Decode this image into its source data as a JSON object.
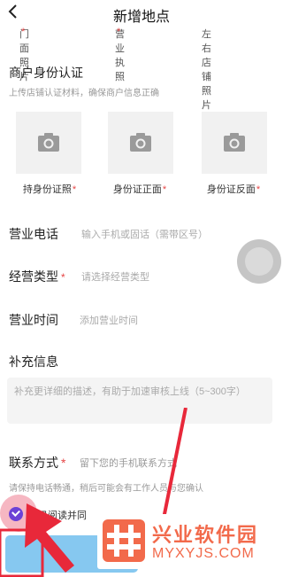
{
  "nav": {
    "title": "新增地点"
  },
  "photo_labels_top": [
    {
      "label": "门面照片"
    },
    {
      "label": "营业执照"
    },
    {
      "label": "左右店铺照片"
    }
  ],
  "identity": {
    "title": "商户身份认证",
    "subtitle": "上传店铺认证材料，确保商户信息正确",
    "photos": [
      {
        "label": "持身份证照"
      },
      {
        "label": "身份证正面"
      },
      {
        "label": "身份证反面"
      }
    ]
  },
  "form": {
    "phone": {
      "label": "营业电话",
      "placeholder": "输入手机或固话（需带区号）"
    },
    "category": {
      "label": "经营类型",
      "placeholder": "请选择经营类型"
    },
    "hours": {
      "label": "营业时间",
      "placeholder": "添加营业时间"
    }
  },
  "supplement": {
    "title": "补充信息",
    "placeholder": "补充更详细的描述，有助于加速审核上线（5~300字）"
  },
  "contact": {
    "label": "联系方式",
    "placeholder": "留下您的手机联系方式",
    "note": "请保持电话畅通，稍后可能会有工作人员与您确认"
  },
  "agreement": {
    "text": "我已阅读并同"
  },
  "required_mark": "*",
  "watermark": {
    "name": "兴业软件园",
    "url": "MYXYJS.COM"
  },
  "colors": {
    "required": "#e64545",
    "check": "#6b42d6",
    "submit": "#86c8f0",
    "watermark": "#f26a4b"
  }
}
